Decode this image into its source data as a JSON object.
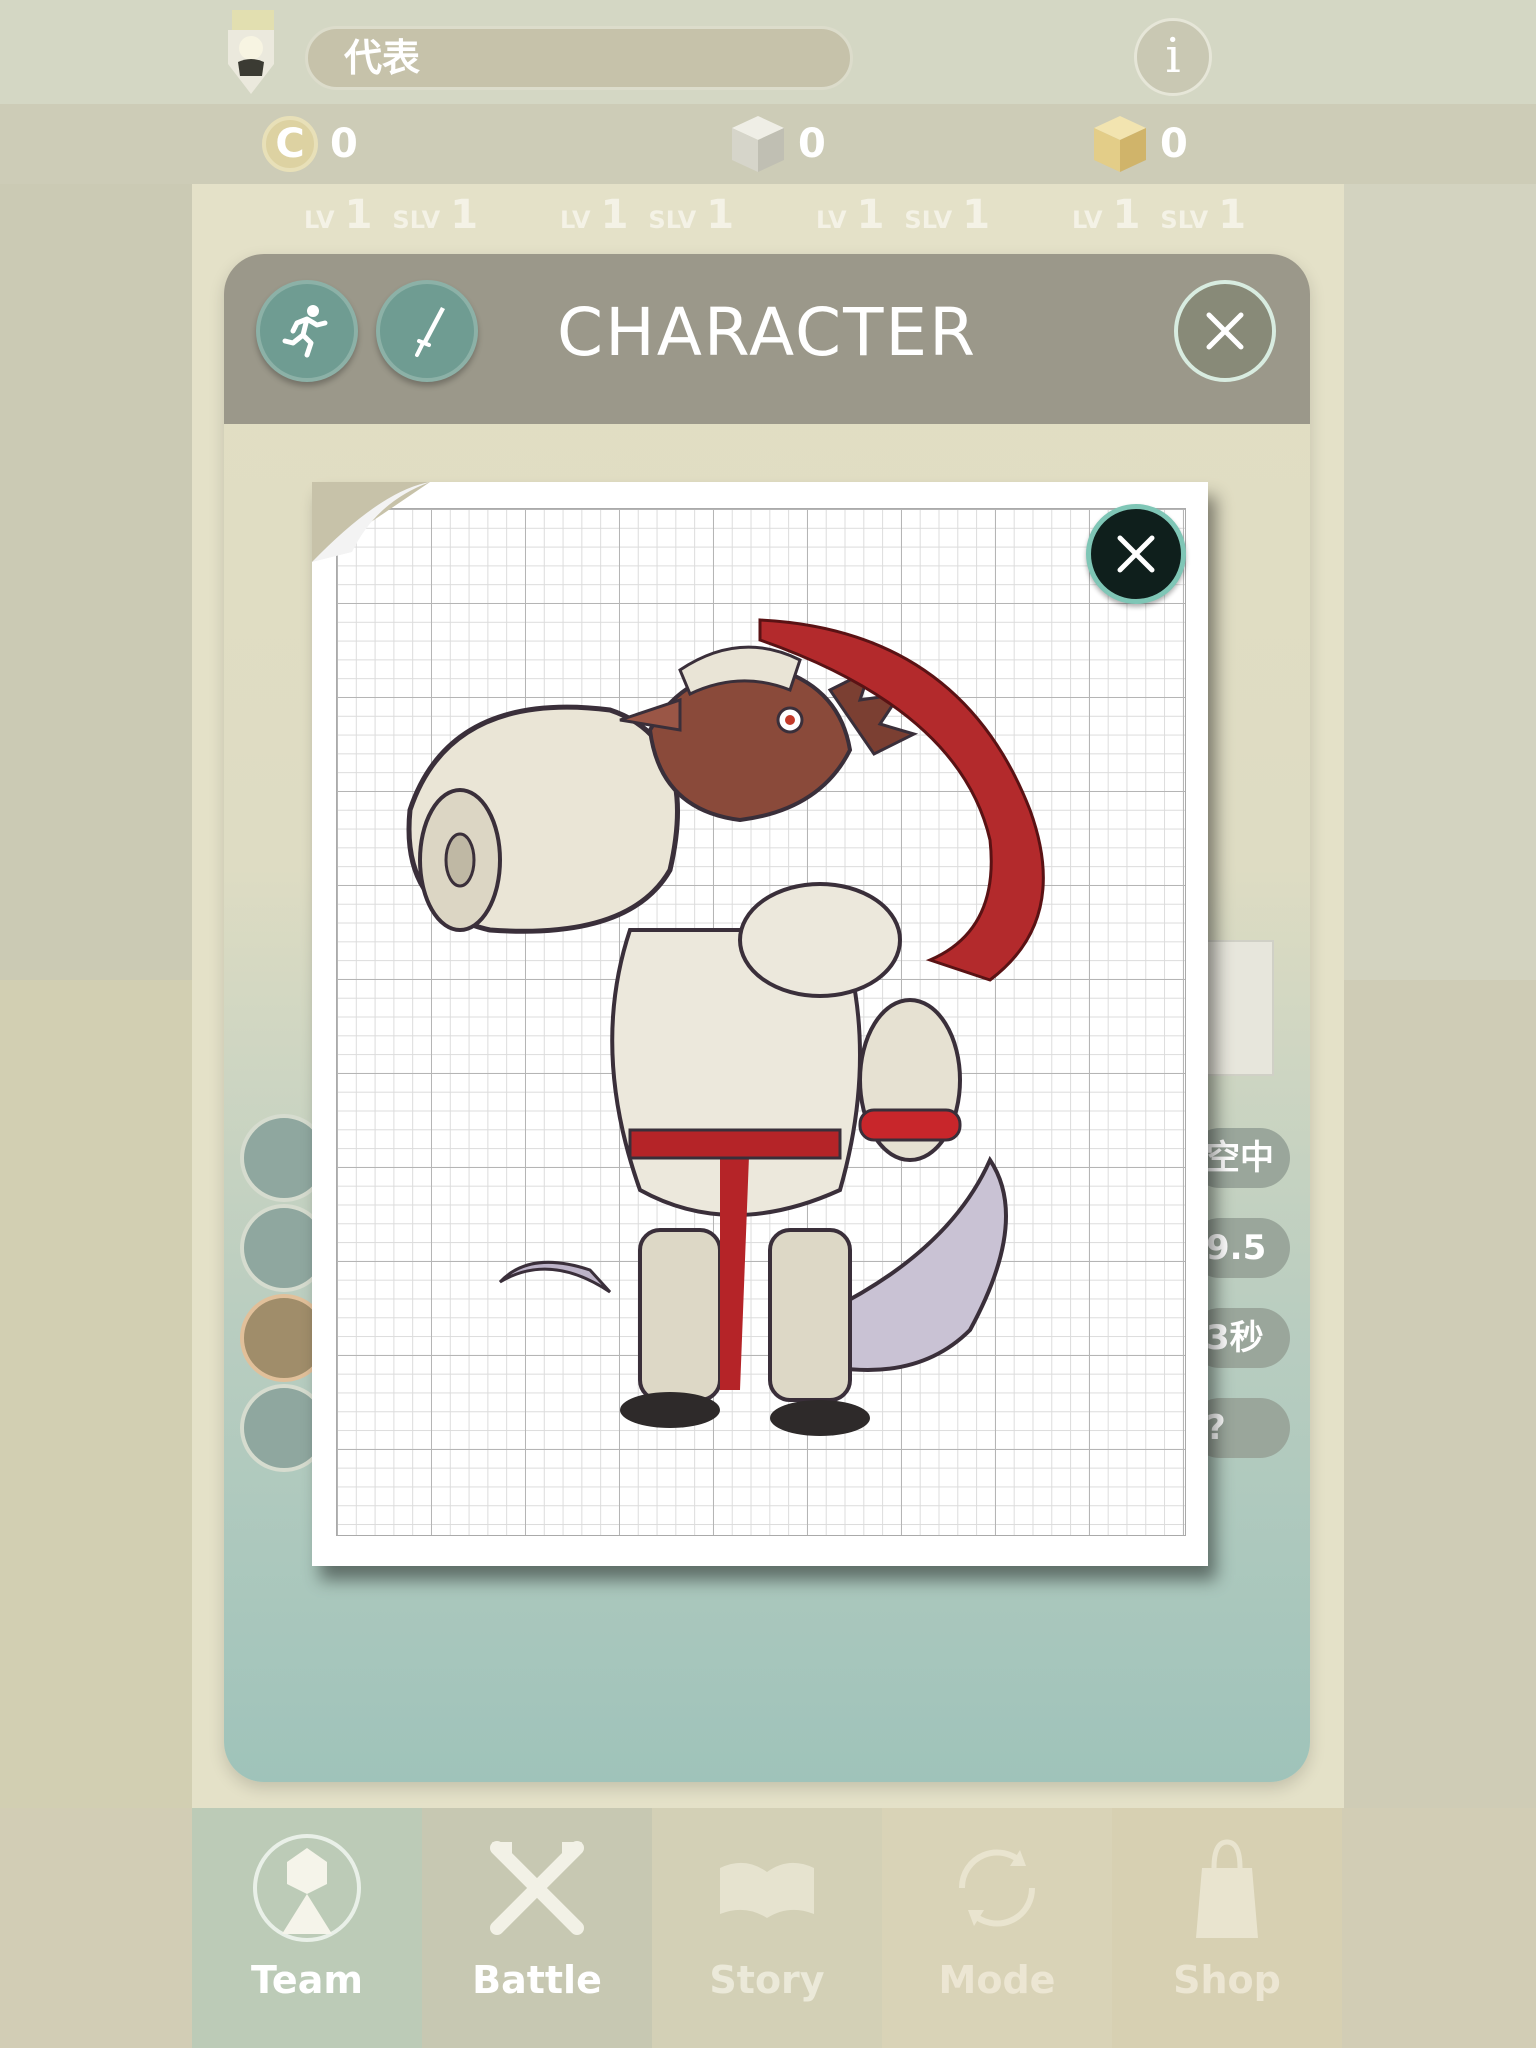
{
  "header": {
    "team_name": "代表",
    "info_label": "i"
  },
  "currencies": [
    {
      "icon": "coin-icon",
      "symbol": "C",
      "value": "0"
    },
    {
      "icon": "gray-cube-icon",
      "value": "0"
    },
    {
      "icon": "gold-cube-icon",
      "value": "0"
    }
  ],
  "levels": [
    {
      "lv_label": "LV",
      "lv": "1",
      "slv_label": "SLV",
      "slv": "1"
    },
    {
      "lv_label": "LV",
      "lv": "1",
      "slv_label": "SLV",
      "slv": "1"
    },
    {
      "lv_label": "LV",
      "lv": "1",
      "slv_label": "SLV",
      "slv": "1"
    },
    {
      "lv_label": "LV",
      "lv": "1",
      "slv_label": "SLV",
      "slv": "1"
    }
  ],
  "background_stats": [
    "空中",
    "9.5",
    "3秒",
    "?"
  ],
  "modal": {
    "title": "CHARACTER",
    "tab_icons": [
      "running-icon",
      "sword-icon"
    ],
    "character_image": "armored-lizard-knight-illustration"
  },
  "nav": [
    {
      "label": "Team",
      "icon": "team-icon",
      "active": true
    },
    {
      "label": "Battle",
      "icon": "crossed-swords-icon",
      "active": false
    },
    {
      "label": "Story",
      "icon": "book-icon",
      "active": false
    },
    {
      "label": "Mode",
      "icon": "cycle-icon",
      "active": false
    },
    {
      "label": "Shop",
      "icon": "shopping-bag-icon",
      "active": false
    }
  ],
  "colors": {
    "accent_teal": "#6f9c92",
    "header_gray": "#9b988a",
    "close_dark": "#0f1f1c"
  }
}
